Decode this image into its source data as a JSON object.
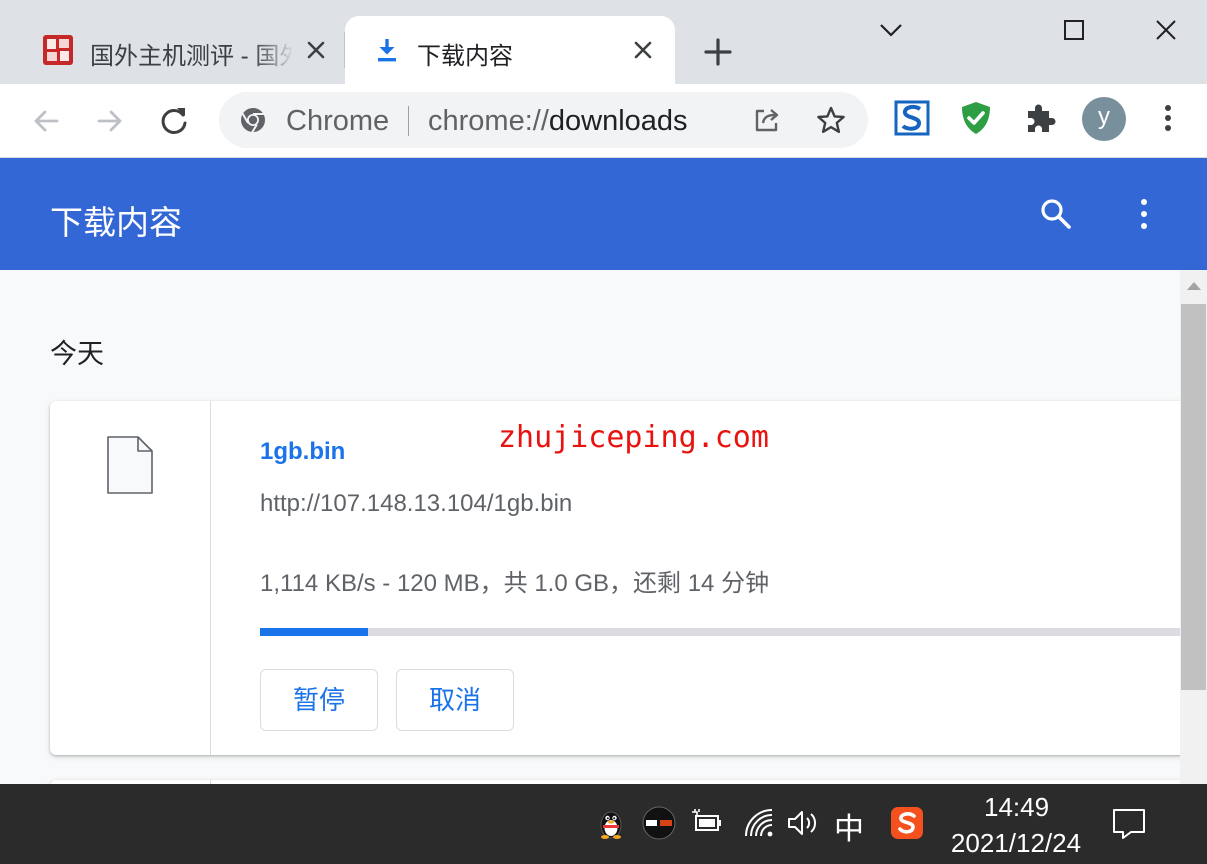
{
  "tabs": [
    {
      "title": "国外主机测评 - 国外",
      "favicon": "zhujiceping-favicon",
      "active": false
    },
    {
      "title": "下载内容",
      "favicon": "download-icon",
      "active": true
    }
  ],
  "omnibox": {
    "chip_label": "Chrome",
    "url_scheme": "chrome://",
    "url_host": "downloads"
  },
  "profile": {
    "initial": "y"
  },
  "downloads_page": {
    "title": "下载内容",
    "date_group": "今天",
    "item": {
      "file_name": "1gb.bin",
      "url": "http://107.148.13.104/1gb.bin",
      "status": "1,114 KB/s - 120 MB，共 1.0 GB，还剩 14 分钟",
      "progress_fraction": 0.117,
      "pause_label": "暂停",
      "cancel_label": "取消"
    }
  },
  "watermark": "zhujiceping.com",
  "taskbar": {
    "ime_indicator": "中",
    "time": "14:49",
    "date": "2021/12/24"
  },
  "colors": {
    "header_blue": "#3367d6",
    "link_blue": "#1a73e8",
    "watermark_red": "#e8130f",
    "taskbar": "#2b2b2b"
  }
}
